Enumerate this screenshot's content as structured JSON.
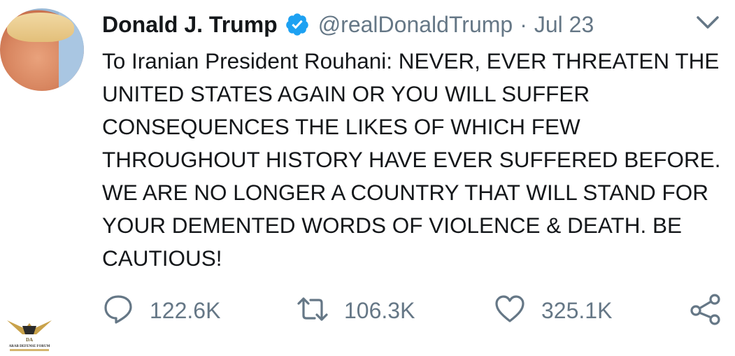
{
  "tweet": {
    "author_name": "Donald J. Trump",
    "handle": "@realDonaldTrump",
    "separator": "·",
    "date": "Jul 23",
    "text": "To Iranian President Rouhani: NEVER, EVER THREATEN THE UNITED STATES AGAIN OR YOU WILL SUFFER CONSEQUENCES THE LIKES OF WHICH FEW THROUGHOUT HISTORY HAVE EVER SUFFERED BEFORE. WE ARE NO LONGER A COUNTRY THAT WILL STAND FOR YOUR DEMENTED WORDS OF VIOLENCE & DEATH. BE CAUTIOUS!"
  },
  "actions": {
    "reply_count": "122.6K",
    "retweet_count": "106.3K",
    "like_count": "325.1K"
  },
  "watermark": {
    "line1": "DA",
    "line2": "ARAB DEFENSE FORUM"
  },
  "colors": {
    "text": "#14171a",
    "secondary": "#657786",
    "verified_blue": "#1da1f2"
  },
  "icons": {
    "verified": "verified-badge-icon",
    "menu": "chevron-down-icon",
    "reply": "reply-icon",
    "retweet": "retweet-icon",
    "like": "heart-icon",
    "share": "share-icon"
  }
}
